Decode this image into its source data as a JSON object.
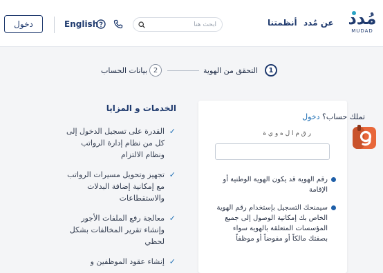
{
  "header": {
    "login_label": "دخول",
    "language_label": "English",
    "search_placeholder": "ابحث هنا",
    "nav": {
      "our_systems": "أنظمتنا",
      "about": "عن مُدد"
    },
    "logo": {
      "arabic": "مُدد",
      "english": "MUDAD"
    }
  },
  "steps": {
    "step1": {
      "number": "1",
      "label": "التحقق من الهوية"
    },
    "step2": {
      "number": "2",
      "label": "بيانات الحساب"
    }
  },
  "services": {
    "title": "الخدمات و المزايا",
    "items": [
      {
        "text": "القدرة على تسجيل الدخول إلى كل من نظام إدارة الرواتب ونظام الالتزام"
      },
      {
        "text": "تجهيز وتحويل مسيرات الرواتب مع إمكانية إضافة البدلات والاستقطاعات"
      },
      {
        "text": "معالجة رفع الملفات الأجور وإنشاء تقرير المخالفات بشكل لحظي"
      },
      {
        "text": "إنشاء عقود الموظفين و"
      }
    ]
  },
  "login_card": {
    "question": "تملك حساب؟",
    "login_link": "دخول",
    "field_label": "ر ق م ا ل ه و ي ة",
    "notes": [
      "رقم الهوية قد يكون الهوية الوطنية أو الإقامة",
      "سيمنحك التسجيل بإستخدام رقم الهوية الخاص بك إمكانية الوصول إلى جميع المؤسسات المتعلقة بالهوية سواء بصفتك مالكاً أو مفوضاً أو موظفاً"
    ]
  },
  "colors": {
    "primary": "#1f3a6e",
    "accent": "#1f6fb5",
    "floating_icon": "#e8673a"
  },
  "icons": {
    "help": "question-circle-icon",
    "phone": "phone-icon",
    "search": "search-icon",
    "check": "check-icon",
    "floating": "app-badge-icon"
  }
}
